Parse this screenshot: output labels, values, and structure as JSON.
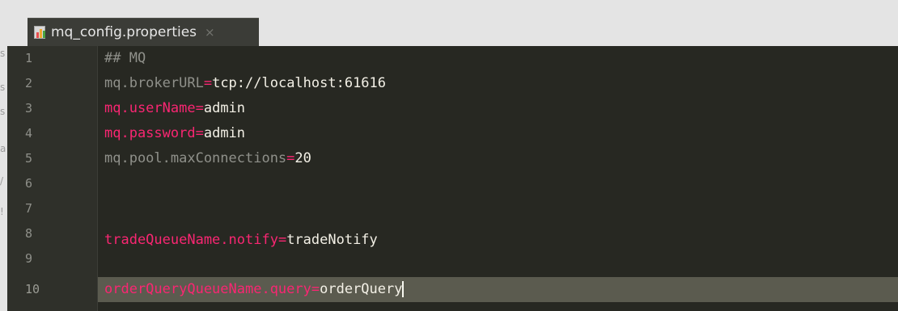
{
  "editor": {
    "tab": {
      "title": "mq_config.properties",
      "close_glyph": "×",
      "icon": "properties-file-icon"
    },
    "left_strip_glyphs": [
      "s",
      "s",
      "s",
      "a",
      "/",
      "!"
    ],
    "line_numbers": [
      "1",
      "2",
      "3",
      "4",
      "5",
      "6",
      "7",
      "8",
      "9",
      "10"
    ],
    "lines": [
      {
        "comment": "## MQ"
      },
      {
        "key": "mq.brokerURL",
        "eq": "=",
        "value": "tcp://localhost:61616",
        "key_style": "dim"
      },
      {
        "key": "mq.userName",
        "eq": "=",
        "value": "admin",
        "key_style": "accent"
      },
      {
        "key": "mq.password",
        "eq": "=",
        "value": "admin",
        "key_style": "accent"
      },
      {
        "key": "mq.pool.maxConnections",
        "eq": "=",
        "value": "20",
        "key_style": "dim"
      },
      {
        "text": ""
      },
      {
        "text": ""
      },
      {
        "key": "tradeQueueName.notify",
        "eq": "=",
        "value": "tradeNotify",
        "key_style": "accent"
      },
      {
        "text": ""
      },
      {
        "key": "orderQueryQueueName.query",
        "eq": "=",
        "value": "orderQuery",
        "key_style": "accent"
      }
    ],
    "current_line": "10",
    "colors": {
      "background": "#272822",
      "gutter": "#2f302a",
      "current_line": "#5b5b4f",
      "key_accent": "#f92672",
      "comment": "#8f908a",
      "value": "#e6e2d6"
    }
  }
}
